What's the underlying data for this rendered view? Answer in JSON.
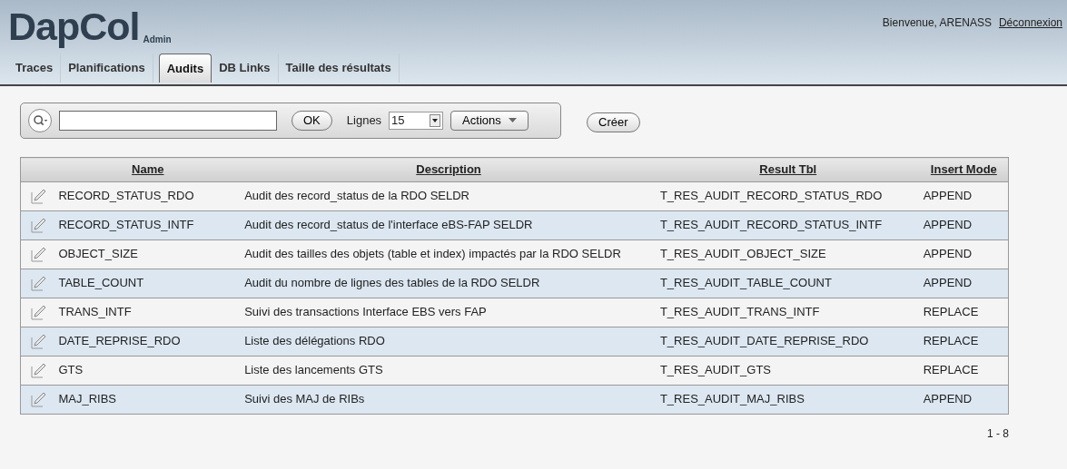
{
  "app": {
    "logo": "DapCol",
    "subtitle": "Admin",
    "welcome": "Bienvenue, ARENASS",
    "logout": "Déconnexion"
  },
  "tabs": [
    {
      "label": "Traces",
      "selected": false
    },
    {
      "label": "Planifications",
      "selected": false
    },
    {
      "label": "Audits",
      "selected": true
    },
    {
      "label": "DB Links",
      "selected": false
    },
    {
      "label": "Taille des résultats",
      "selected": false
    }
  ],
  "toolbar": {
    "ok": "OK",
    "rows_label": "Lignes",
    "rows_value": "15",
    "actions": "Actions",
    "create": "Créer"
  },
  "table": {
    "columns": [
      "Name",
      "Description",
      "Result Tbl",
      "Insert Mode"
    ],
    "rows": [
      {
        "name": "RECORD_STATUS_RDO",
        "description": "Audit des record_status de la RDO SELDR",
        "result": "T_RES_AUDIT_RECORD_STATUS_RDO",
        "mode": "APPEND"
      },
      {
        "name": "RECORD_STATUS_INTF",
        "description": "Audit des record_status de l'interface eBS-FAP SELDR",
        "result": "T_RES_AUDIT_RECORD_STATUS_INTF",
        "mode": "APPEND"
      },
      {
        "name": "OBJECT_SIZE",
        "description": "Audit des tailles des objets (table et index) impactés par la RDO SELDR",
        "result": "T_RES_AUDIT_OBJECT_SIZE",
        "mode": "APPEND"
      },
      {
        "name": "TABLE_COUNT",
        "description": "Audit du nombre de lignes des tables de la RDO SELDR",
        "result": "T_RES_AUDIT_TABLE_COUNT",
        "mode": "APPEND"
      },
      {
        "name": "TRANS_INTF",
        "description": "Suivi des transactions Interface EBS vers FAP",
        "result": "T_RES_AUDIT_TRANS_INTF",
        "mode": "REPLACE"
      },
      {
        "name": "DATE_REPRISE_RDO",
        "description": "Liste des délégations RDO",
        "result": "T_RES_AUDIT_DATE_REPRISE_RDO",
        "mode": "REPLACE"
      },
      {
        "name": "GTS",
        "description": "Liste des lancements GTS",
        "result": "T_RES_AUDIT_GTS",
        "mode": "REPLACE"
      },
      {
        "name": "MAJ_RIBS",
        "description": "Suivi des MAJ de RIBs",
        "result": "T_RES_AUDIT_MAJ_RIBS",
        "mode": "APPEND"
      }
    ]
  },
  "pagination": "1 - 8"
}
